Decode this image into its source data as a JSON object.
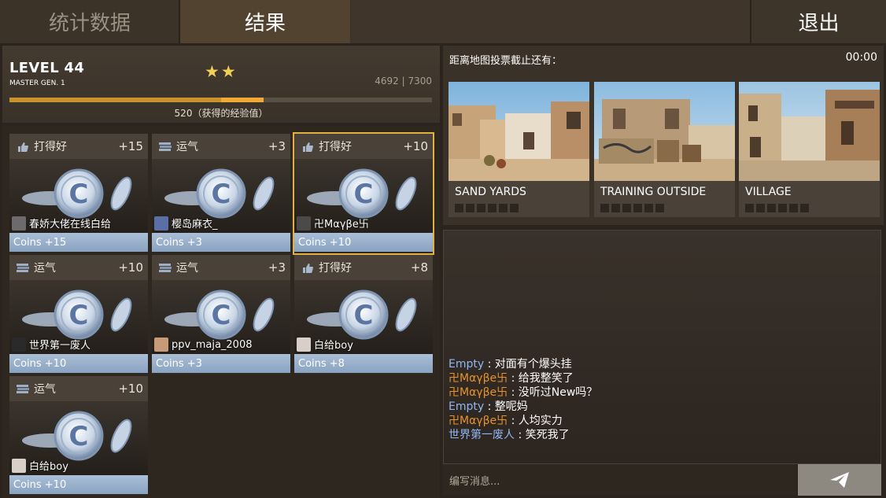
{
  "tabs": {
    "stats": "统计数据",
    "results": "结果",
    "exit": "退出"
  },
  "level": {
    "title": "LEVEL 44",
    "subtitle": "MASTER GEN. 1",
    "stars": "★★",
    "xp_text": "4692 | 7300",
    "xp_fraction": 0.5,
    "gained_fraction": 0.1,
    "xp_caption": "520（获得的经验值）"
  },
  "rewards": [
    {
      "icon": "thumbs-up-icon",
      "label": "打得好",
      "points": "+15",
      "player": "春娇大佬在线白给",
      "coins": "Coins +15"
    },
    {
      "icon": "luck-icon",
      "label": "运气",
      "points": "+3",
      "player": "樱岛麻衣_",
      "coins": "Coins +3"
    },
    {
      "icon": "thumbs-up-icon",
      "label": "打得好",
      "points": "+10",
      "player": "卍Μαγβe卐",
      "coins": "Coins +10"
    },
    {
      "icon": "luck-icon",
      "label": "运气",
      "points": "+10",
      "player": "世界第一废人",
      "coins": "Coins +10"
    },
    {
      "icon": "luck-icon",
      "label": "运气",
      "points": "+3",
      "player": "ppv_maja_2008",
      "coins": "Coins +3"
    },
    {
      "icon": "thumbs-up-icon",
      "label": "打得好",
      "points": "+8",
      "player": "白给boy",
      "coins": "Coins +8"
    },
    {
      "icon": "luck-icon",
      "label": "运气",
      "points": "+10",
      "player": "白给boy",
      "coins": "Coins +10"
    }
  ],
  "map_vote": {
    "title": "距离地图投票截止还有：",
    "timer": "00:00",
    "maps": [
      {
        "name": "SAND YARDS"
      },
      {
        "name": "TRAINING OUTSIDE"
      },
      {
        "name": "VILLAGE"
      }
    ]
  },
  "chat": {
    "messages": [
      {
        "name": "Empty",
        "color": "blue",
        "text": "对面有个爆头挂"
      },
      {
        "name": "卍Μαγβe卐",
        "color": "orange",
        "text": "给我整笑了"
      },
      {
        "name": "卍Μαγβe卐",
        "color": "orange",
        "text": "没听过New吗？"
      },
      {
        "name": "Empty",
        "color": "blue",
        "text": "整呢妈"
      },
      {
        "name": "卍Μαγβe卐",
        "color": "orange",
        "text": "人均实力"
      },
      {
        "name": "世界第一废人",
        "color": "blue",
        "text": "笑死我了"
      }
    ],
    "placeholder": "编写消息...",
    "separator": " : "
  }
}
